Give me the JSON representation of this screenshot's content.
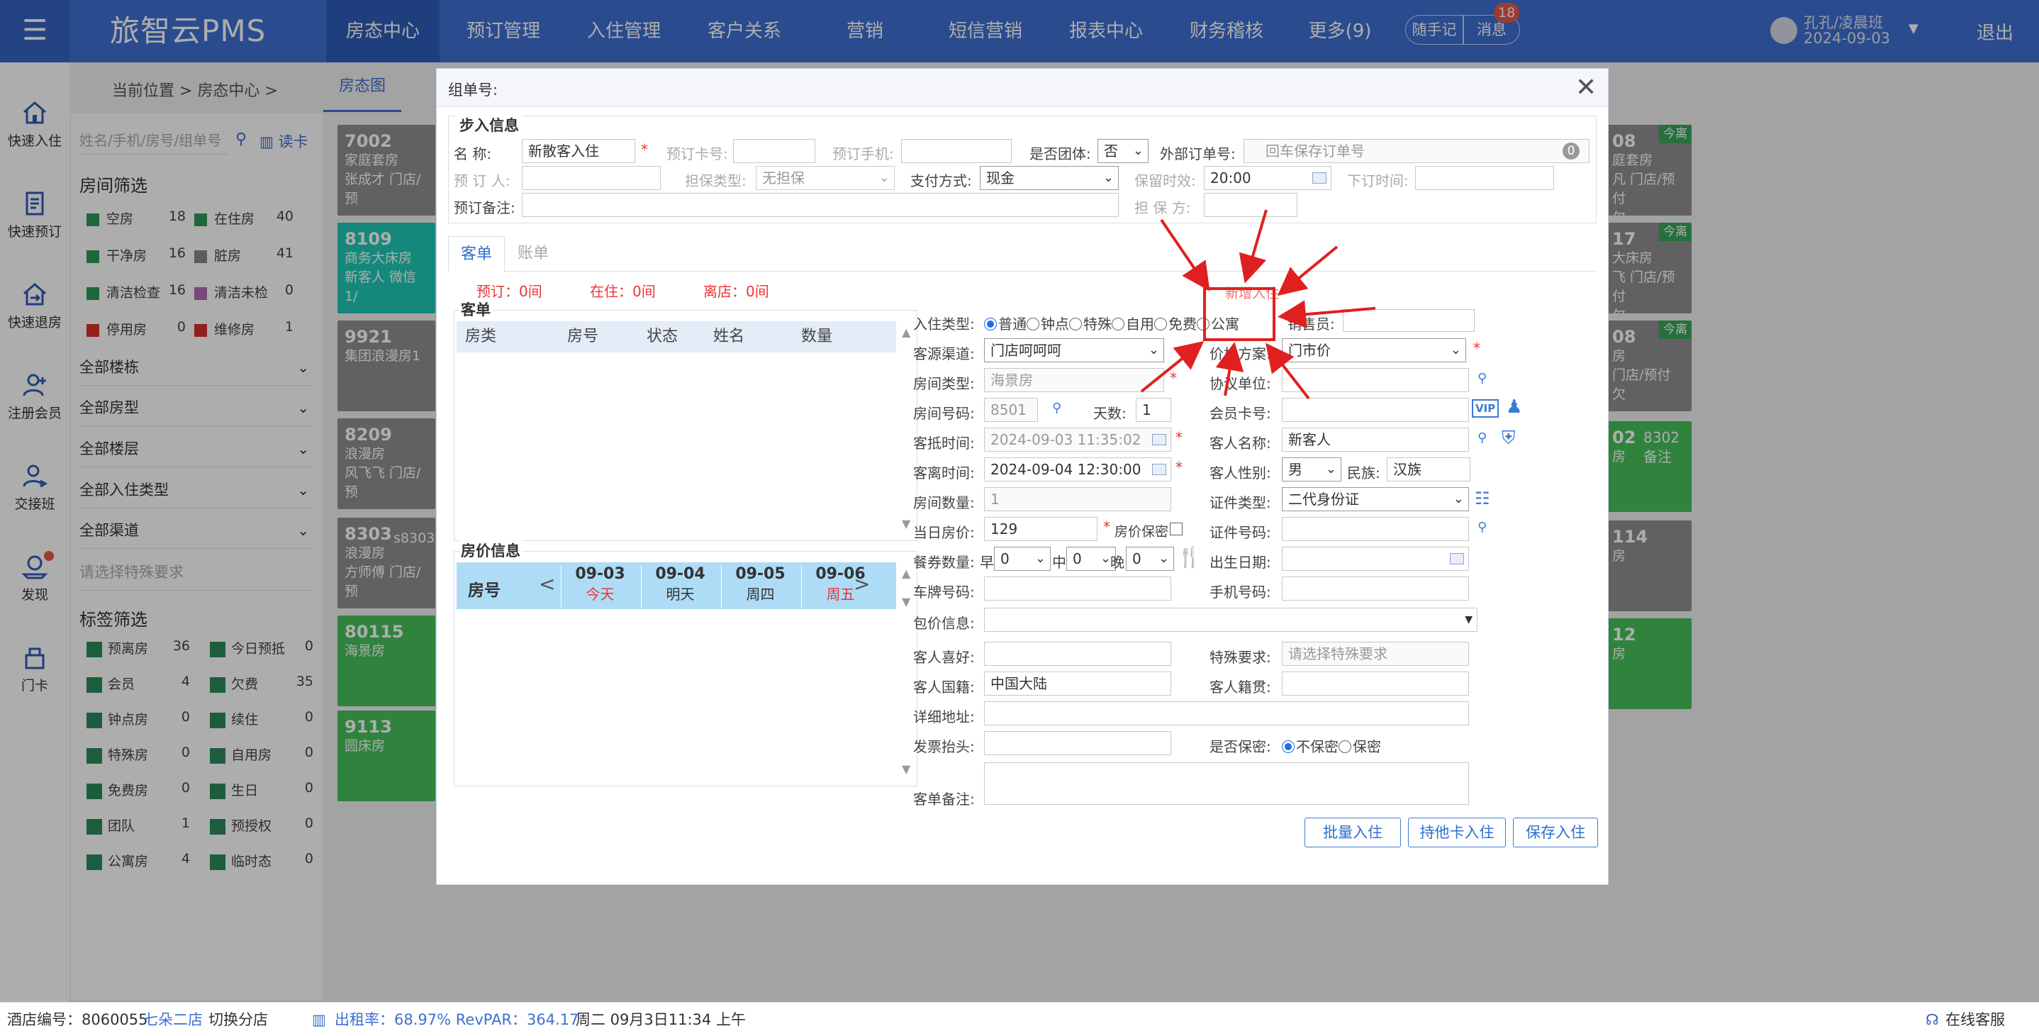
{
  "app": {
    "logo": "旅智云PMS"
  },
  "nav": {
    "items": [
      "房态中心",
      "预订管理",
      "入住管理",
      "客户关系",
      "营销",
      "短信营销",
      "报表中心",
      "财务稽核",
      "更多(9)"
    ],
    "note": "随手记",
    "message": "消息",
    "message_count": "18",
    "user_name": "孔孔/凌晨班",
    "user_date": "2024-09-03",
    "logout": "退出"
  },
  "leftnav": [
    "快速入住",
    "快速预订",
    "快速退房",
    "注册会员",
    "交接班",
    "发现",
    "门卡"
  ],
  "background": {
    "breadcrumb": "当前位置 > 房态中心 >",
    "tab": "房态图",
    "search_placeholder": "姓名/手机/房号/组单号",
    "read_card": "读卡",
    "room_filter_title": "房间筛选",
    "room_filters": [
      {
        "label": "空房",
        "count": "18",
        "color": "#2e9a57"
      },
      {
        "label": "在住房",
        "count": "40",
        "color": "#2e9a57"
      },
      {
        "label": "干净房",
        "count": "16",
        "color": "#2e9a57"
      },
      {
        "label": "脏房",
        "count": "41",
        "color": "#888888"
      },
      {
        "label": "清洁检查",
        "count": "16",
        "color": "#2e9a57"
      },
      {
        "label": "清洁未检",
        "count": "0",
        "color": "#b06ab3"
      },
      {
        "label": "停用房",
        "count": "0",
        "color": "#d9302c"
      },
      {
        "label": "维修房",
        "count": "1",
        "color": "#d9302c"
      }
    ],
    "selects": [
      "全部楼栋",
      "全部房型",
      "全部楼层",
      "全部入住类型",
      "全部渠道"
    ],
    "special_placeholder": "请选择特殊要求",
    "tag_filter_title": "标签筛选",
    "tag_filters": [
      {
        "label": "预离房",
        "count": "36"
      },
      {
        "label": "今日预抵",
        "count": "0"
      },
      {
        "label": "会员",
        "count": "4"
      },
      {
        "label": "欠费",
        "count": "35"
      },
      {
        "label": "钟点房",
        "count": "0"
      },
      {
        "label": "续住",
        "count": "0"
      },
      {
        "label": "特殊房",
        "count": "0"
      },
      {
        "label": "自用房",
        "count": "0"
      },
      {
        "label": "免费房",
        "count": "0"
      },
      {
        "label": "生日",
        "count": "0"
      },
      {
        "label": "团队",
        "count": "1"
      },
      {
        "label": "预授权",
        "count": "0"
      },
      {
        "label": "公寓房",
        "count": "4"
      },
      {
        "label": "临时态",
        "count": "0"
      }
    ],
    "left_cards": [
      {
        "no": "7002",
        "lines": [
          "家庭套房",
          "张成才 门店/预"
        ],
        "tone": "gray"
      },
      {
        "no": "8109",
        "lines": [
          "商务大床房",
          "新客人 微信1/"
        ],
        "tone": "teal"
      },
      {
        "no": "9921",
        "lines": [
          "集团浪漫房1"
        ],
        "tone": "gray"
      },
      {
        "no": "8209",
        "lines": [
          "浪漫房",
          "风飞飞 门店/预"
        ],
        "tone": "gray"
      },
      {
        "no": "8303",
        "lines": [
          "浪漫房",
          "方师傅 门店/预"
        ],
        "tone": "gray"
      },
      {
        "no": "80115",
        "lines": [
          "海景房"
        ],
        "tone": "green"
      },
      {
        "no": "9113",
        "lines": [
          "圆床房"
        ],
        "tone": "green"
      }
    ],
    "card_8303_note": "s8303",
    "right_cards": [
      {
        "no": "08",
        "lines": [
          "庭套房",
          "凡 门店/预付",
          "欠"
        ],
        "tone": "gray",
        "today": "今离"
      },
      {
        "no": "17",
        "lines": [
          "大床房",
          "飞 门店/预付",
          "欠"
        ],
        "tone": "gray",
        "today": "今离"
      },
      {
        "no": "08",
        "lines": [
          "房",
          "门店/预付",
          "欠"
        ],
        "tone": "gray",
        "today": "今离"
      },
      {
        "no": "02",
        "lines": [
          "房"
        ],
        "tone": "green",
        "note": "8302备注"
      },
      {
        "no": "114",
        "lines": [
          "房"
        ],
        "tone": "gray"
      },
      {
        "no": "12",
        "lines": [
          "房"
        ],
        "tone": "green"
      }
    ]
  },
  "status": {
    "hotel_no_label": "酒店编号：8060055",
    "hotel_name": "七朵二店",
    "switch": "切换分店",
    "occupancy": "出租率：68.97% RevPAR：364.17",
    "datetime": "周二 09月3日11:34 上午",
    "service": "在线客服"
  },
  "dialog": {
    "title": "组单号:",
    "walkin_title": "步入信息",
    "name_label": "名    称:",
    "name_value": "新散客入住",
    "booking_card_label": "预订卡号:",
    "booking_phone_label": "预订手机:",
    "is_group_label": "是否团体:",
    "is_group_value": "否",
    "ext_order_label": "外部订单号:",
    "ext_order_placeholder": "回车保存订单号",
    "ext_order_count": "0",
    "booker_label": "预 订 人:",
    "guarantee_label": "担保类型:",
    "guarantee_value": "无担保",
    "payment_label": "支付方式:",
    "payment_value": "现金",
    "hold_label": "保留时效:",
    "hold_value": "20:00",
    "order_time_label": "下订时间:",
    "booking_remark_label": "预订备注:",
    "guarantor_label": "担 保 方:",
    "tabs": [
      "客单",
      "账单"
    ],
    "counts": [
      "预订：0间",
      "在住：0间",
      "离店：0间"
    ],
    "guest_list_title": "客单",
    "guest_list_columns": [
      "房类",
      "房号",
      "状态",
      "姓名",
      "数量"
    ],
    "price_title": "房价信息",
    "price_room_label": "房号",
    "price_days": [
      {
        "date": "09-03",
        "weekday": "今天"
      },
      {
        "date": "09-04",
        "weekday": "明天"
      },
      {
        "date": "09-05",
        "weekday": "周四"
      },
      {
        "date": "09-06",
        "weekday": "周五"
      }
    ],
    "checkin_type_label": "入住类型:",
    "checkin_types": [
      "普通",
      "钟点",
      "特殊",
      "自用",
      "免费",
      "公寓"
    ],
    "new_checkin_hint": "新增入住",
    "sales_label": "销售员:",
    "channel_label": "客源渠道:",
    "channel_value": "门店呵呵呵",
    "price_plan_label": "价格方案:",
    "price_plan_value": "门市价",
    "room_type_label": "房间类型:",
    "room_type_value": "海景房",
    "agreement_label": "协议单位:",
    "room_no_label": "房间号码:",
    "room_no_value": "8501",
    "days_label": "天数:",
    "days_value": "1",
    "member_card_label": "会员卡号:",
    "vip_badge": "VIP",
    "arrive_label": "客抵时间:",
    "arrive_value": "2024-09-03 11:35:02",
    "guest_name_label": "客人名称:",
    "guest_name_value": "新客人",
    "depart_label": "客离时间:",
    "depart_value": "2024-09-04 12:30:00",
    "gender_label": "客人性别:",
    "gender_value": "男",
    "ethnicity_label": "民族:",
    "ethnicity_value": "汉族",
    "room_count_label": "房间数量:",
    "room_count_value": "1",
    "id_type_label": "证件类型:",
    "id_type_value": "二代身份证",
    "rate_label": "当日房价:",
    "rate_value": "129",
    "rate_secret_label": "房价保密",
    "id_no_label": "证件号码:",
    "meal_label": "餐券数量:",
    "meal_breakfast": "早",
    "meal_lunch": "中",
    "meal_dinner": "晚",
    "meal_values": [
      "0",
      "0",
      "0"
    ],
    "birthday_label": "出生日期:",
    "plate_label": "车牌号码:",
    "mobile_label": "手机号码:",
    "package_label": "包价信息:",
    "hobby_label": "客人喜好:",
    "special_label": "特殊要求:",
    "special_placeholder": "请选择特殊要求",
    "nationality_label": "客人国籍:",
    "nationality_value": "中国大陆",
    "native_label": "客人籍贯:",
    "address_label": "详细地址:",
    "invoice_label": "发票抬头:",
    "secret_label": "是否保密:",
    "secret_options": [
      "不保密",
      "保密"
    ],
    "remark_label": "客单备注:",
    "buttons": [
      "批量入住",
      "持他卡入住",
      "保存入住"
    ]
  },
  "colors": {
    "brand": "#3f6fd1",
    "accent_red": "#e33",
    "highlight_box": "#e02020"
  }
}
